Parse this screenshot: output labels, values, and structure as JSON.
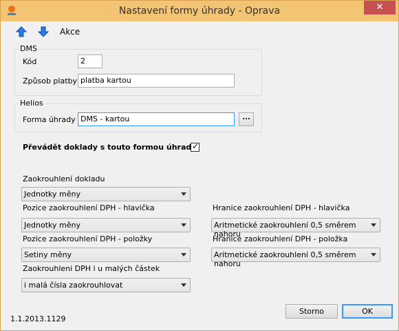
{
  "window": {
    "title": "Nastavení formy úhrady - Oprava",
    "close_label": "✕"
  },
  "toolbar": {
    "actions_label": "Akce"
  },
  "dms": {
    "legend": "DMS",
    "code_label": "Kód",
    "code_value": "2",
    "method_label": "Způsob platby",
    "method_value": "platba kartou"
  },
  "helios": {
    "legend": "Helios",
    "form_label": "Forma úhrady",
    "form_value": "DMS - kartou",
    "browse_label": "..."
  },
  "transfer": {
    "label": "Převádět doklady s touto formou úhrady",
    "checked": true
  },
  "rounding": {
    "document_label": "Zaokrouhlení dokladu",
    "document_value": "Jednotky měny",
    "vat_header_pos_label": "Pozice zaokrouhlení DPH - hlavička",
    "vat_header_pos_value": "Jednotky měny",
    "vat_header_limit_label": "Hranice zaokrouhlení DPH - hlavička",
    "vat_header_limit_value": "Aritmetické zaokrouhlení 0,5 směrem nahoru",
    "vat_item_pos_label": "Pozice zaokrouhlení DPH - položky",
    "vat_item_pos_value": "Setiny měny",
    "vat_item_limit_label": "Hranice zaokrouhlení DPH - položka",
    "vat_item_limit_value": "Aritmetické zaokrouhlení 0,5 směrem nahoru",
    "small_amounts_label": "Zaokrouhleni DPH i u malých částek",
    "small_amounts_value": "i malá čísla zaokrouhlovat"
  },
  "footer": {
    "version": "1.1.2013.1129",
    "cancel_label": "Storno",
    "ok_label": "OK"
  },
  "colors": {
    "titlebar": "#f2c474",
    "close": "#c75050",
    "accent_arrow": "#1e6fd9"
  }
}
